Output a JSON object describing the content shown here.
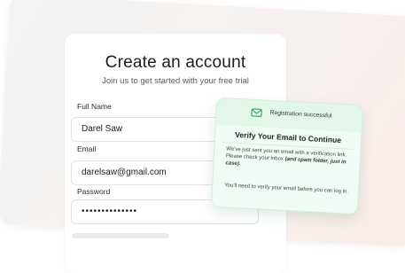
{
  "form": {
    "title": "Create an account",
    "subtitle": "Join us to get started with your free trial",
    "full_name_label": "Full Name",
    "full_name_value": "Darel Saw",
    "email_label": "Email",
    "email_value": "darelsaw@gmail.com",
    "password_label": "Password",
    "password_value": "••••••••••••••"
  },
  "toast": {
    "status": "Registration successful",
    "title": "Verify Your Email to Continue",
    "message": "We've just sent you an email with a verification link. Please check your inbox",
    "message_note": "(and spam folder, just in case).",
    "message_2": "You'll need to verify your email before you can log in.",
    "icon": "mail-icon",
    "accent_color": "#2f9e5c"
  },
  "colors": {
    "background": "#f4efec",
    "toast_bg": "#f1fbf5"
  }
}
